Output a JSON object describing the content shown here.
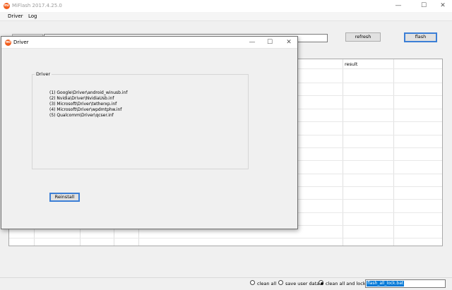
{
  "app": {
    "title": "MiFlash 2017.4.25.0",
    "logo_text": "mi"
  },
  "window_controls": {
    "minimize": "—",
    "maximize": "☐",
    "close": "✕"
  },
  "menu": [
    "Driver",
    "Log"
  ],
  "toolbar": {
    "path_value": "",
    "refresh_label": "refresh",
    "flash_label": "flash"
  },
  "grid": {
    "columns": [
      "",
      "",
      "",
      "",
      "result",
      ""
    ]
  },
  "status": {
    "options": [
      {
        "label": "clean all",
        "selected": false
      },
      {
        "label": "save user data",
        "selected": false
      },
      {
        "label": "clean all and lock",
        "selected": true
      }
    ],
    "script": "flash_all_lock.bat"
  },
  "dialog": {
    "title": "Driver",
    "group_label": "Driver",
    "drivers": [
      "(1) Google\\Driver\\android_winusb.inf",
      "(2) Nvidia\\Driver\\NvidiaUsb.inf",
      "(3) Microsoft\\Driver\\tetherxp.inf",
      "(4) Microsoft\\Driver\\wpdmtphw.inf",
      "(5) Qualcomm\\Driver\\qcser.inf"
    ],
    "reinstall_label": "Reinstall"
  },
  "colors": {
    "accent": "#3c7fd6",
    "logo": "#f25d1c",
    "selection": "#0078d7"
  }
}
